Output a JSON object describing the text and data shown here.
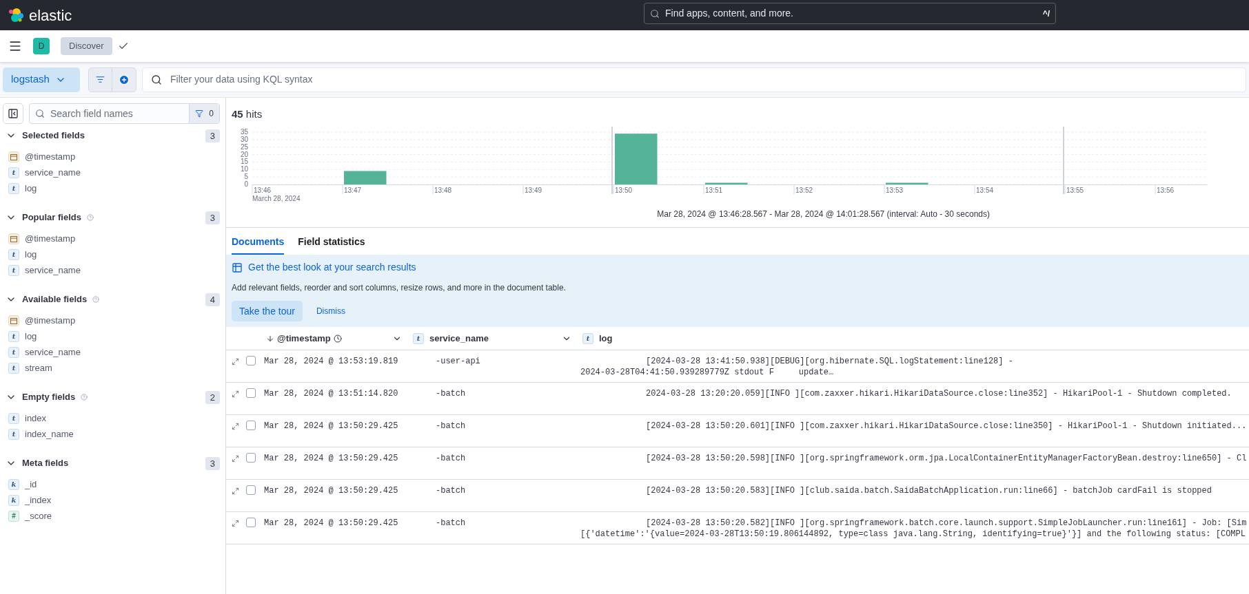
{
  "header": {
    "brand": "elastic",
    "search": {
      "placeholder": "Find apps, content, and more.",
      "shortcut": "^/"
    }
  },
  "app_bar": {
    "space": "D",
    "breadcrumb": "Discover"
  },
  "query_bar": {
    "data_view": "logstash",
    "placeholder": "Filter your data using KQL syntax"
  },
  "sidebar": {
    "search": {
      "placeholder": "Search field names"
    },
    "filter_count": "0",
    "sections": [
      {
        "title": "Selected fields",
        "count": "3",
        "help": false,
        "expanded": true,
        "fields": [
          {
            "name": "@timestamp",
            "kind": "date"
          },
          {
            "name": "service_name",
            "kind": "string",
            "glyph": "t"
          },
          {
            "name": "log",
            "kind": "string",
            "glyph": "t"
          }
        ]
      },
      {
        "title": "Popular fields",
        "count": "3",
        "help": true,
        "expanded": true,
        "fields": [
          {
            "name": "@timestamp",
            "kind": "date"
          },
          {
            "name": "log",
            "kind": "string",
            "glyph": "t"
          },
          {
            "name": "service_name",
            "kind": "string",
            "glyph": "t"
          }
        ]
      },
      {
        "title": "Available fields",
        "count": "4",
        "help": true,
        "expanded": true,
        "fields": [
          {
            "name": "@timestamp",
            "kind": "date"
          },
          {
            "name": "log",
            "kind": "string",
            "glyph": "t"
          },
          {
            "name": "service_name",
            "kind": "string",
            "glyph": "t"
          },
          {
            "name": "stream",
            "kind": "string",
            "glyph": "t"
          }
        ]
      },
      {
        "title": "Empty fields",
        "count": "2",
        "help": true,
        "expanded": true,
        "fields": [
          {
            "name": "index",
            "kind": "string",
            "glyph": "t"
          },
          {
            "name": "index_name",
            "kind": "string",
            "glyph": "t"
          }
        ]
      },
      {
        "title": "Meta fields",
        "count": "3",
        "help": false,
        "expanded": true,
        "fields": [
          {
            "name": "_id",
            "kind": "keyword",
            "glyph": "k"
          },
          {
            "name": "_index",
            "kind": "keyword",
            "glyph": "k"
          },
          {
            "name": "_score",
            "kind": "number",
            "glyph": "#"
          }
        ]
      }
    ]
  },
  "hits": "**45** hits",
  "histogram": {
    "time_range": "Mar 28, 2024 @ 13:46:28.567 - Mar 28, 2024 @ 14:01:28.567 (interval: Auto - 30 seconds)",
    "chart_data": {
      "type": "bar",
      "xlabel": "March 28, 2024",
      "grid": true,
      "categories": [
        "13:46",
        null,
        "13:47",
        null,
        "13:48",
        null,
        "13:49",
        null,
        "13:50",
        null,
        "13:51",
        null,
        "13:52",
        null,
        "13:53",
        null,
        "13:54",
        null,
        "13:55",
        null,
        "13:56"
      ],
      "series": [
        {
          "color": "#54b399",
          "values": [
            0,
            0,
            9,
            0,
            0,
            0,
            0,
            0,
            34,
            0,
            1,
            0,
            0,
            0,
            1,
            0,
            0,
            0,
            0,
            0,
            0
          ]
        }
      ],
      "ylim": [
        0,
        35
      ],
      "yticks": [
        0,
        5,
        10,
        15,
        20,
        25,
        30,
        35
      ]
    }
  },
  "tabs": [
    {
      "label": "Documents",
      "selected": true
    },
    {
      "label": "Field statistics",
      "selected": false
    }
  ],
  "callout": {
    "title": "Get the best look at your search results",
    "text": "Add relevant fields, reorder and sort columns, resize rows, and more in the document table.",
    "primary": "Take the tour",
    "secondary": "Dismiss"
  },
  "table": {
    "columns": [
      {
        "label": "@timestamp",
        "kind": "date"
      },
      {
        "label": "service_name",
        "kind": "string",
        "glyph": "t"
      },
      {
        "label": "log",
        "kind": "string",
        "glyph": "t"
      }
    ],
    "rows": [
      {
        "checked": false,
        "timestamp": "Mar 28, 2024 @ 13:53:19.819",
        "service": "-user-api",
        "log": [
          "[2024-03-28 13:41:50.938][DEBUG][org.hibernate.SQL.logStatement:line128] -",
          "2024-03-28T04:41:50.939289779Z stdout F     update…"
        ]
      },
      {
        "checked": false,
        "timestamp": "Mar 28, 2024 @ 13:51:14.820",
        "service": "-batch",
        "log": [
          "2024-03-28 13:20:20.059][INFO ][com.zaxxer.hikari.HikariDataSource.close:line352] - HikariPool-1 - Shutdown completed."
        ]
      },
      {
        "checked": false,
        "timestamp": "Mar 28, 2024 @ 13:50:29.425",
        "service": "-batch",
        "log": [
          "[2024-03-28 13:50:20.601][INFO ][com.zaxxer.hikari.HikariDataSource.close:line350] - HikariPool-1 - Shutdown initiated..."
        ]
      },
      {
        "checked": false,
        "timestamp": "Mar 28, 2024 @ 13:50:29.425",
        "service": "-batch",
        "log": [
          "[2024-03-28 13:50:20.598][INFO ][org.springframework.orm.jpa.LocalContainerEntityManagerFactoryBean.destroy:line650] - Cl"
        ]
      },
      {
        "checked": false,
        "timestamp": "Mar 28, 2024 @ 13:50:29.425",
        "service": "-batch",
        "log": [
          "[2024-03-28 13:50:20.583][INFO ][club.saida.batch.SaidaBatchApplication.run:line66] - batchJob cardFail is stopped"
        ]
      },
      {
        "checked": false,
        "timestamp": "Mar 28, 2024 @ 13:50:29.425",
        "service": "-batch",
        "log": [
          "[2024-03-28 13:50:20.582][INFO ][org.springframework.batch.core.launch.support.SimpleJobLauncher.run:line161] - Job: [Sim",
          "[{'datetime':'{value=2024-03-28T13:50:19.806144892, type=class java.lang.String, identifying=true}'}] and the following status: [COMPL"
        ]
      }
    ]
  }
}
